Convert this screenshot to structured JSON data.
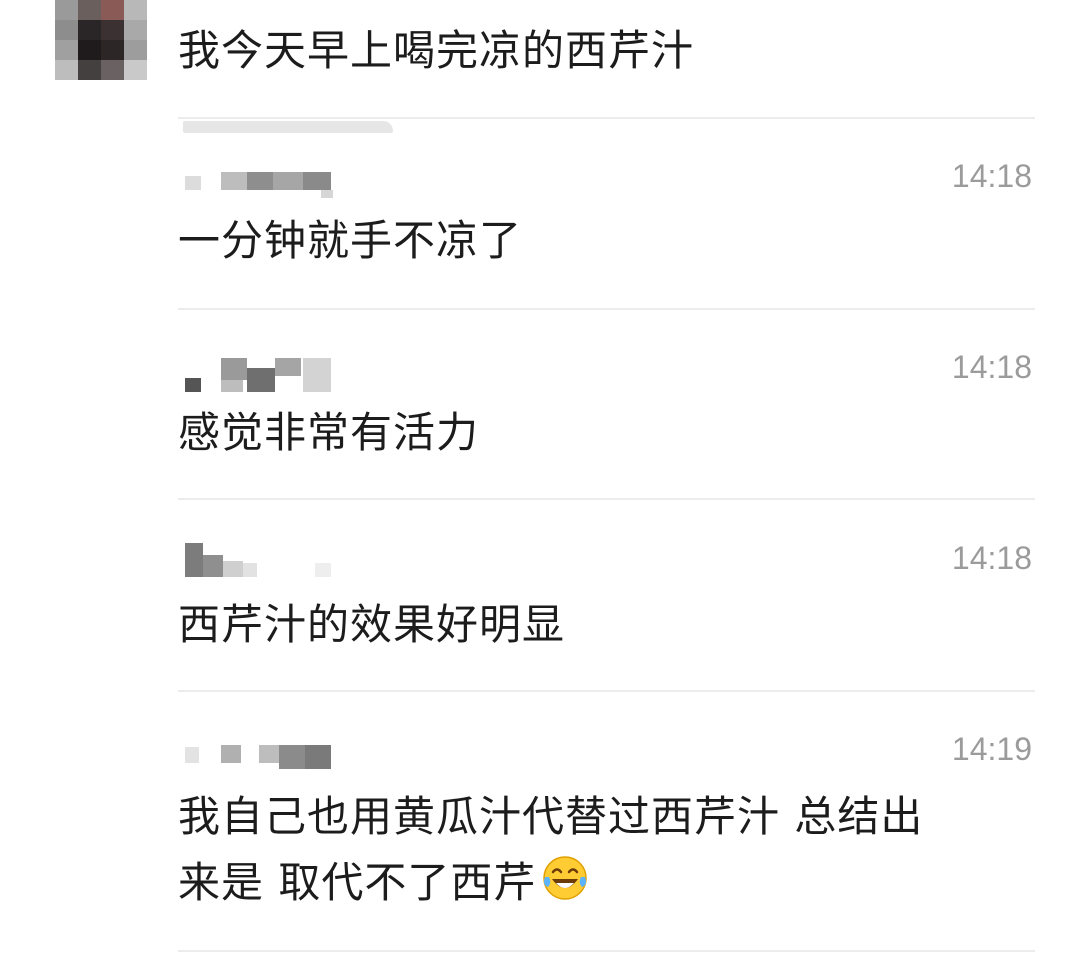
{
  "top_message": {
    "text": "我今天早上喝完凉的西芹汁"
  },
  "comments": [
    {
      "time": "14:18",
      "text": "一分钟就手不凉了"
    },
    {
      "time": "14:18",
      "text": "感觉非常有活力"
    },
    {
      "time": "14:18",
      "text": "西芹汁的效果好明显"
    },
    {
      "time": "14:19",
      "text_line1": "我自己也用黄瓜汁代替过西芹汁 总结出",
      "text_line2": "来是 取代不了西芹",
      "emoji": "laughing-with-tears"
    }
  ],
  "colors": {
    "text": "#1c1c1c",
    "time": "#9b9b9b",
    "divider": "#ececec"
  }
}
